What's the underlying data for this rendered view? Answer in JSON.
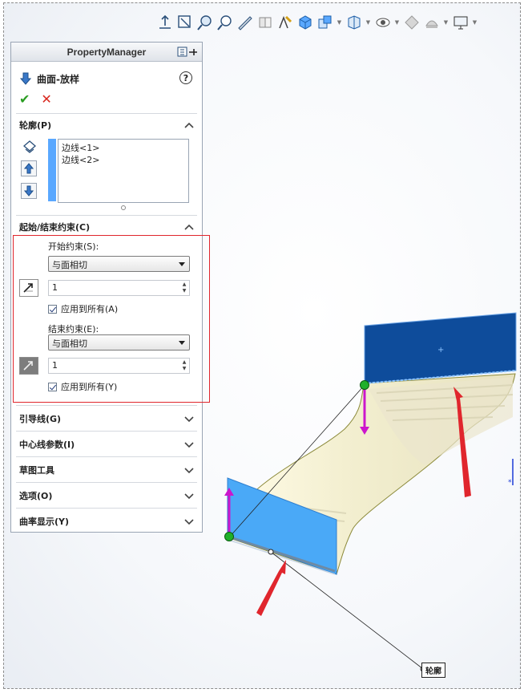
{
  "property_manager": {
    "title": "PropertyManager",
    "feature_title": "曲面-放样",
    "help_symbol": "?",
    "ok_symbol": "✔",
    "cancel_symbol": "✕"
  },
  "profiles_section": {
    "label": "轮廓(P)",
    "items": [
      "边线<1>",
      "边线<2>"
    ]
  },
  "constraint_section": {
    "label": "起始/结束约束(C)",
    "start_label": "开始约束(S):",
    "start_value": "与面相切",
    "start_tangent_length": "1",
    "start_apply_all": "应用到所有(A)",
    "end_label": "结束约束(E):",
    "end_value": "与面相切",
    "end_tangent_length": "1",
    "end_apply_all": "应用到所有(Y)"
  },
  "collapsed_sections": {
    "guide_curves": "引导线(G)",
    "centerline": "中心线参数(I)",
    "sketch_tools": "草图工具",
    "options": "选项(O)",
    "curvature": "曲率显示(Y)"
  },
  "viewport": {
    "callout_label": "轮廓"
  },
  "colors": {
    "face_dark": "#0e4c9b",
    "face_light": "#4aa9f7",
    "surface": "#e8e4c4",
    "arrow_magenta": "#cc16cc",
    "annotation_red": "#e0262d",
    "point_green": "#20b02a",
    "list_bar": "#5aa8ff"
  }
}
